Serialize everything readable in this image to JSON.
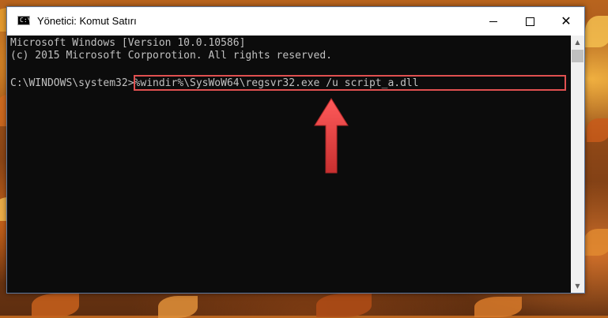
{
  "window": {
    "title": "Yönetici: Komut Satırı",
    "icon_label": "C:\\",
    "controls": {
      "minimize_icon": "minimize-icon",
      "maximize_icon": "maximize-icon",
      "close_icon": "close-icon",
      "close_glyph": "✕"
    }
  },
  "console": {
    "line1": "Microsoft Windows [Version 10.0.10586]",
    "line2": "(c) 2015 Microsoft Corporotion. All rights reserved.",
    "prompt": "C:\\WINDOWS\\system32>",
    "command": "%windir%\\SysWoW64\\regsvr32.exe /u script_a.dll"
  },
  "colors": {
    "console_bg": "#0c0c0c",
    "console_text": "#c0c0c0",
    "highlight_border": "#e05050",
    "arrow": "#e04848"
  },
  "scrollbar": {
    "up_glyph": "▲",
    "down_glyph": "▼"
  }
}
